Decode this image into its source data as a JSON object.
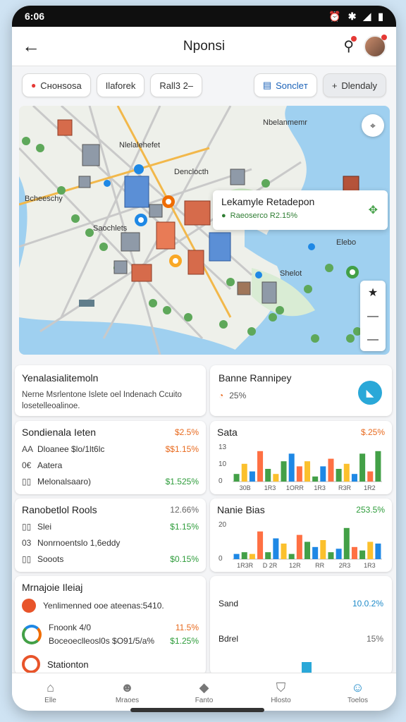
{
  "status": {
    "time": "6:06"
  },
  "appbar": {
    "title": "Nponsi"
  },
  "chips": [
    {
      "label": "Cнонsоsa",
      "kind": "location"
    },
    {
      "label": "Ilaforek"
    },
    {
      "label": "Rall3 2–"
    },
    {
      "label": "Soncleт",
      "kind": "selected"
    },
    {
      "label": "Dlendaly",
      "kind": "plus"
    }
  ],
  "map": {
    "labels": {
      "l1": "Nlelalehefet",
      "l2": "Nbelanmemr",
      "l3": "Denclocth",
      "l4": "Bcheeschy",
      "l5": "Saochlets",
      "l6": "Shelot",
      "l7": "Elebo"
    },
    "popup": {
      "title": "Lekamyle Retadepon",
      "subtitle": "Raeoserco R2.15%"
    }
  },
  "cards": {
    "summary": {
      "title": "Yenalasialitemoln",
      "text": "Nerne Msrlentone Islete oel Indenach Ccuito losetelleoalinoe."
    },
    "banner": {
      "title": "Banne Rannipey",
      "value": "25%"
    },
    "sondienal": {
      "title": "Sondienala Ieten",
      "header_value": "$2.5%",
      "rows": [
        {
          "icon": "AA",
          "label": "Dloanee $lo/1lt6lc",
          "value": "$$1.15%",
          "color": "orange"
        },
        {
          "icon": "0€",
          "label": "Aatera",
          "value": "",
          "color": "gray"
        },
        {
          "icon": "▯▯",
          "label": "Melonalsaaro)",
          "value": "$1.525%",
          "color": "green"
        }
      ]
    },
    "sata": {
      "title": "Sata",
      "header_value": "$.25%"
    },
    "ranobetel": {
      "title": "Ranobetlol Rools",
      "header_value": "12.66%",
      "rows": [
        {
          "icon": "▯▯",
          "label": "Slei",
          "value": "$1.15%",
          "color": "green"
        },
        {
          "icon": "03",
          "label": "Nonrnoentslo 1,6eddy",
          "value": "",
          "color": "gray"
        },
        {
          "icon": "▯▯",
          "label": "Sooots",
          "value": "$0.15%",
          "color": "green"
        }
      ]
    },
    "nanis": {
      "title": "Nanie Bias",
      "header_value": "253.5%"
    },
    "majoie": {
      "title": "Mrnajoie Ileiaj",
      "rows": [
        {
          "label": "Yenlimenned ooe ateenas:5410.",
          "value": "",
          "color": "orange"
        },
        {
          "label": "Fnoonk 4/0",
          "value": "11.5%",
          "color": "orange"
        },
        {
          "label": "Boceoeclleosl0s $O91/5/a%",
          "value": "$1.25%",
          "color": "green"
        },
        {
          "label": "Stationton",
          "value": "",
          "color": "gray"
        }
      ]
    },
    "right_bottom": {
      "rows": [
        {
          "label": "Sand",
          "value": "10.0.2%",
          "color": "blue"
        },
        {
          "label": "Bdrel",
          "value": "15%",
          "color": "gray"
        }
      ]
    }
  },
  "chart_data": [
    {
      "type": "bar",
      "title": "Sata",
      "ylim": [
        0,
        15
      ],
      "yticks": [
        "13",
        "10",
        "0"
      ],
      "categories": [
        "30B",
        "1R3",
        "1ORR",
        "1R3",
        "R3R",
        "1R2"
      ],
      "series": [
        {
          "values": [
            3,
            7,
            4,
            12,
            5,
            3,
            8,
            11,
            6,
            8,
            2,
            6,
            9,
            5,
            7,
            3,
            11,
            4,
            12
          ]
        }
      ],
      "colors": [
        "#43a047",
        "#fbc02d",
        "#1e88e5",
        "#ff7043",
        "#43a047",
        "#fbc02d",
        "#43a047",
        "#1e88e5",
        "#ff7043",
        "#fbc02d",
        "#43a047",
        "#1e88e5",
        "#ff7043",
        "#43a047",
        "#fbc02d",
        "#1e88e5",
        "#43a047",
        "#ff7043",
        "#43a047"
      ]
    },
    {
      "type": "bar",
      "title": "Nanie Bias",
      "ylim": [
        0,
        22
      ],
      "yticks": [
        "20",
        "0"
      ],
      "categories": [
        "1R3R",
        "D 2R",
        "12R",
        "RR",
        "2R3",
        "1R3"
      ],
      "series": [
        {
          "values": [
            3,
            4,
            3,
            16,
            4,
            12,
            9,
            3,
            14,
            10,
            7,
            11,
            4,
            6,
            18,
            7,
            5,
            10,
            9
          ]
        }
      ],
      "colors": [
        "#1e88e5",
        "#43a047",
        "#fbc02d",
        "#ff7043",
        "#43a047",
        "#1e88e5",
        "#fbc02d",
        "#43a047",
        "#ff7043",
        "#43a047",
        "#1e88e5",
        "#fbc02d",
        "#43a047",
        "#1e88e5",
        "#43a047",
        "#ff7043",
        "#43a047",
        "#fbc02d",
        "#1e88e5"
      ]
    }
  ],
  "nav": [
    {
      "label": "Elle",
      "icon": "home-icon"
    },
    {
      "label": "Mraoes",
      "icon": "people-icon"
    },
    {
      "label": "Fanto",
      "icon": "route-icon"
    },
    {
      "label": "Hlosto",
      "icon": "shield-icon"
    },
    {
      "label": "Toelos",
      "icon": "profile-icon"
    }
  ]
}
